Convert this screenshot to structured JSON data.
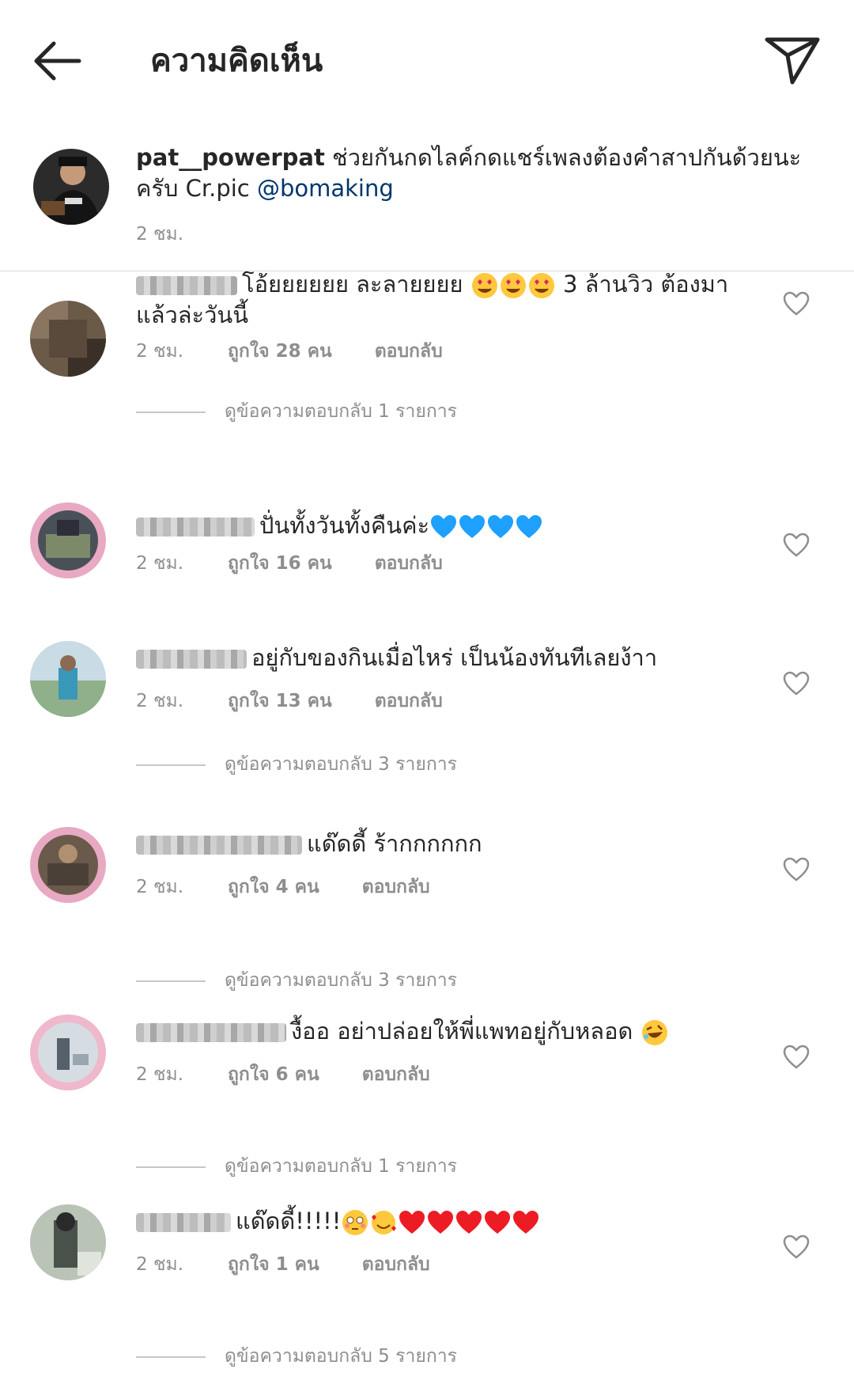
{
  "header": {
    "title": "ความคิดเห็น"
  },
  "caption": {
    "username": "pat__powerpat",
    "text": " ช่วยกันกดไลค์กดแชร์เพลงต้องคำสาปกันด้วยนะครับ Cr.pic ",
    "mention": "@bomaking",
    "time": "2 ชม."
  },
  "comments": [
    {
      "text": "โอ้ยยยยยย ละลายยยย",
      "text2": " 3 ล้านวิว ต้องมาแล้วล่ะวันนี้",
      "emojis": "heart-eyes-emoji x3",
      "time": "2 ชม.",
      "likes": "ถูกใจ 28 คน",
      "reply": "ตอบกลับ",
      "view_replies": "ดูข้อความตอบกลับ 1 รายการ"
    },
    {
      "text": "ปั่นทั้งวันทั้งคืนค่ะ",
      "emojis": "blue-heart-emoji x4",
      "time": "2 ชม.",
      "likes": "ถูกใจ 16 คน",
      "reply": "ตอบกลับ"
    },
    {
      "text": "อยู่กับของกินเมื่อไหร่ เป็นน้องทันทีเลยง้าา",
      "time": "2 ชม.",
      "likes": "ถูกใจ 13 คน",
      "reply": "ตอบกลับ",
      "view_replies": "ดูข้อความตอบกลับ 3 รายการ"
    },
    {
      "text": "แด๊ดดี้ ร้ากกกกกก",
      "time": "2 ชม.",
      "likes": "ถูกใจ 4 คน",
      "reply": "ตอบกลับ",
      "view_replies": "ดูข้อความตอบกลับ 3 รายการ"
    },
    {
      "text": "งื้ออ อย่าปล่อยให้พี่แพทอยู่กับหลอด",
      "emojis": "rofl-emoji",
      "time": "2 ชม.",
      "likes": "ถูกใจ 6 คน",
      "reply": "ตอบกลับ",
      "view_replies": "ดูข้อความตอบกลับ 1 รายการ"
    },
    {
      "text": "แด๊ดดี้!!!!!",
      "emojis": "flushed, smiling-hearts, red-heart x5",
      "time": "2 ชม.",
      "likes": "ถูกใจ 1 คน",
      "reply": "ตอบกลับ",
      "view_replies": "ดูข้อความตอบกลับ 5 รายการ"
    }
  ],
  "colors": {
    "text": "#262626",
    "muted": "#8e8e8e",
    "mention": "#00376b",
    "blue_heart": "#1ea0ff",
    "red_heart": "#ed1c24"
  }
}
